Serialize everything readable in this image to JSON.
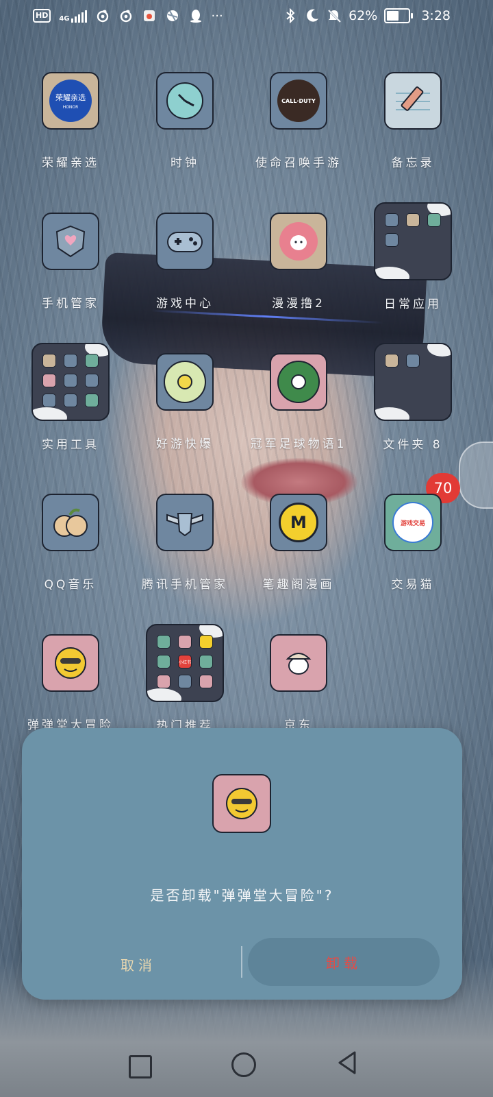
{
  "status_bar": {
    "left_icons": [
      "hd-icon",
      "4g-signal-icon",
      "netease-music-icon",
      "netease-music-icon",
      "app-notification-icon",
      "app-notification-icon",
      "qq-icon"
    ],
    "hd": "HD",
    "network": "4G",
    "more": "···",
    "battery_percent": "62%",
    "battery_level": 0.62,
    "time": "3:28"
  },
  "apps": [
    {
      "label": "荣耀亲选",
      "icon": "honor-select-icon",
      "inner_text": "荣耀亲选",
      "sub_text": "HONOR",
      "color": "#c9b59a"
    },
    {
      "label": "时钟",
      "icon": "clock-icon",
      "color": "#6f87a0"
    },
    {
      "label": "使命召唤手游",
      "icon": "call-of-duty-icon",
      "inner_text": "CALL·DUTY",
      "color": "#6f87a0"
    },
    {
      "label": "备忘录",
      "icon": "notes-icon",
      "color": "#c9d7df"
    },
    {
      "label": "手机管家",
      "icon": "phone-manager-icon",
      "color": "#6f87a0"
    },
    {
      "label": "游戏中心",
      "icon": "game-center-icon",
      "color": "#6f87a0"
    },
    {
      "label": "漫漫撸2",
      "icon": "manmanlu-icon",
      "color": "#c9b59a"
    },
    {
      "label": "日常应用",
      "icon": "folder-icon",
      "folder": true
    },
    {
      "label": "实用工具",
      "icon": "folder-icon",
      "folder": true
    },
    {
      "label": "好游快爆",
      "icon": "haoyou-kuaibao-icon",
      "color": "#6f87a0"
    },
    {
      "label": "冠军足球物语1",
      "icon": "champion-football-icon",
      "color": "#d9a3ad"
    },
    {
      "label": "文件夹 8",
      "icon": "folder-icon",
      "folder": true
    },
    {
      "label": "QQ音乐",
      "icon": "qq-music-icon",
      "color": "#6f87a0"
    },
    {
      "label": "腾讯手机管家",
      "icon": "tencent-manager-icon",
      "color": "#6f87a0"
    },
    {
      "label": "笔趣阁漫画",
      "icon": "biquge-comic-icon",
      "color": "#6f87a0"
    },
    {
      "label": "交易猫",
      "icon": "jiaoyimao-icon",
      "inner_text": "游戏交易",
      "color": "#6fae9b"
    },
    {
      "label": "弹弹堂大冒险",
      "icon": "dandantang-icon",
      "color": "#d9a3ad"
    },
    {
      "label": "热门推荐",
      "icon": "folder-icon",
      "folder": true,
      "inner_text": "小红书"
    },
    {
      "label": "京东",
      "icon": "jd-icon",
      "color": "#d9a3ad"
    }
  ],
  "notification_badge": "70",
  "dialog": {
    "message": "是否卸载\"弹弹堂大冒险\"?",
    "cancel": "取消",
    "uninstall": "卸载",
    "icon": "dandantang-icon"
  },
  "nav": {
    "recent": "recent-apps-icon",
    "home": "home-icon",
    "back": "back-icon"
  }
}
